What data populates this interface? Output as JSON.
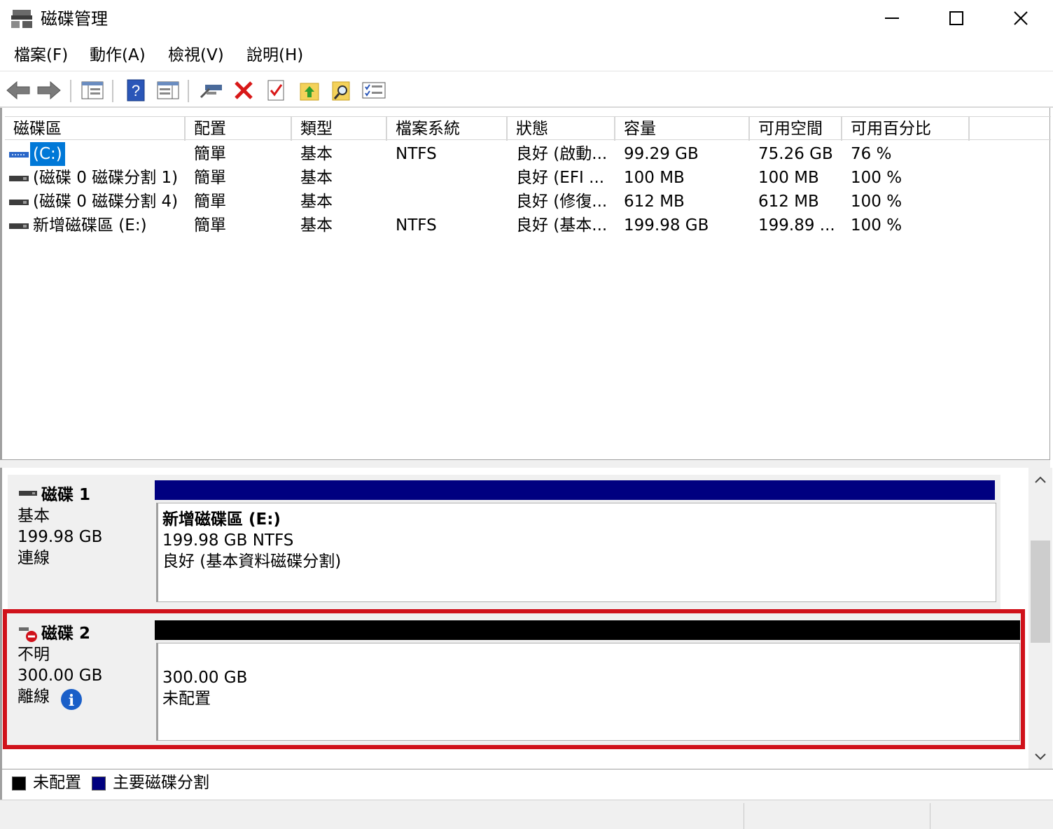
{
  "window": {
    "title": "磁碟管理"
  },
  "menu": [
    "檔案(F)",
    "動作(A)",
    "檢視(V)",
    "說明(H)"
  ],
  "toolbar": {
    "icons": [
      "back-icon",
      "forward-icon",
      "console-tree-icon",
      "help-icon",
      "properties-icon",
      "connect-icon",
      "delete-icon",
      "check-icon",
      "folder-up-icon",
      "search-folder-icon",
      "list-icon"
    ]
  },
  "volume_list": {
    "columns": [
      "磁碟區",
      "配置",
      "類型",
      "檔案系統",
      "狀態",
      "容量",
      "可用空間",
      "可用百分比"
    ],
    "rows": [
      {
        "volume": "(C:)",
        "layout": "簡單",
        "type": "基本",
        "fs": "NTFS",
        "status": "良好 (啟動...",
        "capacity": "99.29 GB",
        "free": "75.26 GB",
        "pct": "76 %"
      },
      {
        "volume": "(磁碟 0 磁碟分割 1)",
        "layout": "簡單",
        "type": "基本",
        "fs": "",
        "status": "良好 (EFI ...",
        "capacity": "100 MB",
        "free": "100 MB",
        "pct": "100 %"
      },
      {
        "volume": "(磁碟 0 磁碟分割 4)",
        "layout": "簡單",
        "type": "基本",
        "fs": "",
        "status": "良好 (修復...",
        "capacity": "612 MB",
        "free": "612 MB",
        "pct": "100 %"
      },
      {
        "volume": "新增磁碟區 (E:)",
        "layout": "簡單",
        "type": "基本",
        "fs": "NTFS",
        "status": "良好 (基本...",
        "capacity": "199.98 GB",
        "free": "199.89 ...",
        "pct": "100 %"
      }
    ]
  },
  "disks": [
    {
      "name": "磁碟 1",
      "kind": "基本",
      "size": "199.98 GB",
      "state": "連線",
      "partition": {
        "title": "新增磁碟區  (E:)",
        "line2": "199.98 GB NTFS",
        "line3": "良好 (基本資料磁碟分割)"
      }
    },
    {
      "name": "磁碟 2",
      "kind": "不明",
      "size": "300.00 GB",
      "state": "離線",
      "partition": {
        "line1": "300.00 GB",
        "line2": "未配置"
      }
    }
  ],
  "legend": [
    {
      "label": "未配置",
      "color": "#000000"
    },
    {
      "label": "主要磁碟分割",
      "color": "#00007f"
    }
  ],
  "colors": {
    "primary_partition": "#000080",
    "unallocated": "#000000",
    "highlight": "#d0121b",
    "selection": "#0078d7"
  }
}
